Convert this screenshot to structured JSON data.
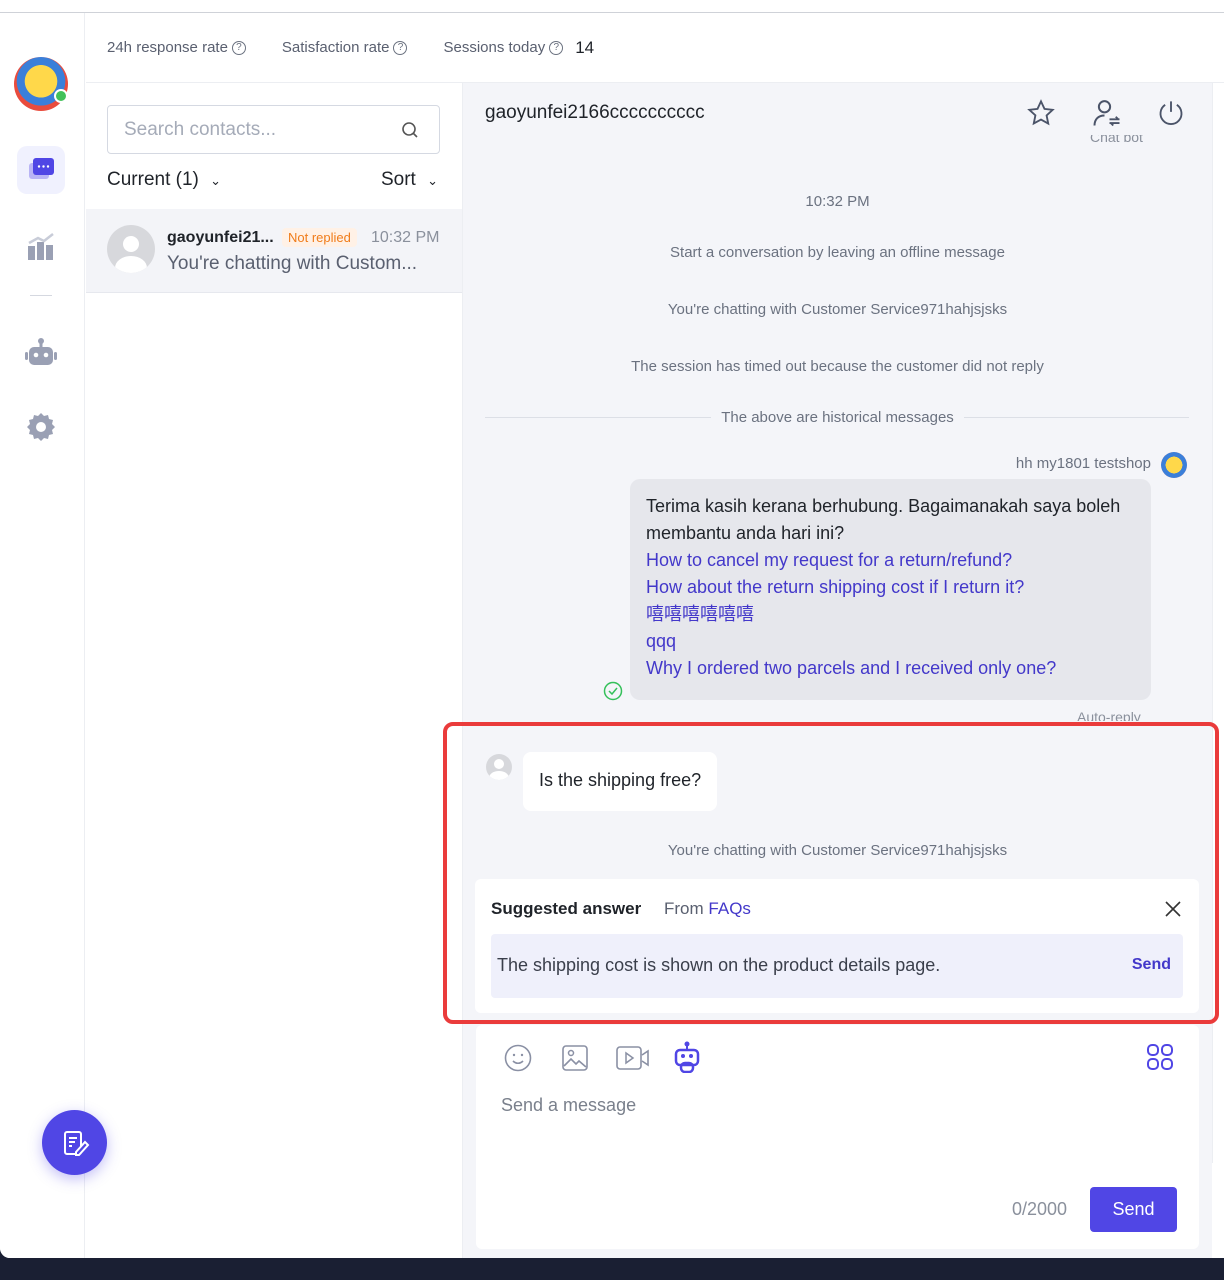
{
  "header": {
    "stats": [
      {
        "label": "24h response rate"
      },
      {
        "label": "Satisfaction rate"
      },
      {
        "label": "Sessions today",
        "value": "14"
      }
    ]
  },
  "sidebar": {
    "items": [
      {
        "icon": "avatar"
      },
      {
        "icon": "chat-icon",
        "active": true
      },
      {
        "icon": "chart-icon"
      },
      {
        "icon": "robot-icon"
      },
      {
        "icon": "gear-icon"
      }
    ]
  },
  "contacts": {
    "search_placeholder": "Search contacts...",
    "filter_label": "Current (1)",
    "sort_label": "Sort",
    "items": [
      {
        "name": "gaoyunfei21...",
        "badge": "Not replied",
        "time": "10:32 PM",
        "preview": "You're chatting with Custom..."
      }
    ]
  },
  "chat": {
    "title": "gaoyunfei2166cccccccccc",
    "chatbot_label": "Chat bot",
    "time": "10:32 PM",
    "system": [
      "Start a conversation by leaving an offline message",
      "You're chatting with Customer Service971hahjsjsks",
      "The session has timed out because the customer did not reply"
    ],
    "divider": "The above are historical messages",
    "agent_name": "hh my1801 testshop",
    "agent_message": "Terima kasih kerana berhubung. Bagaimanakah saya boleh membantu anda hari ini?",
    "faq_links": [
      "How to cancel my request for a return/refund?",
      "How about the return shipping cost if I return it?",
      "嘻嘻嘻嘻嘻嘻",
      "qqq",
      "Why I ordered two parcels and I received only one?"
    ],
    "auto_reply_label": "Auto-reply",
    "customer_message": "Is the shipping free?",
    "system_after": "You're chatting with Customer Service971hahjsjsks",
    "suggestion": {
      "title": "Suggested answer",
      "from": "From",
      "source": "FAQs",
      "text": "The shipping cost is shown on the product details page.",
      "send": "Send"
    },
    "composer": {
      "placeholder": "Send a message",
      "count": "0/2000",
      "send": "Send"
    }
  },
  "colors": {
    "accent": "#5046e5",
    "badge": "#f07c1a",
    "highlight": "#ea3b3b"
  }
}
